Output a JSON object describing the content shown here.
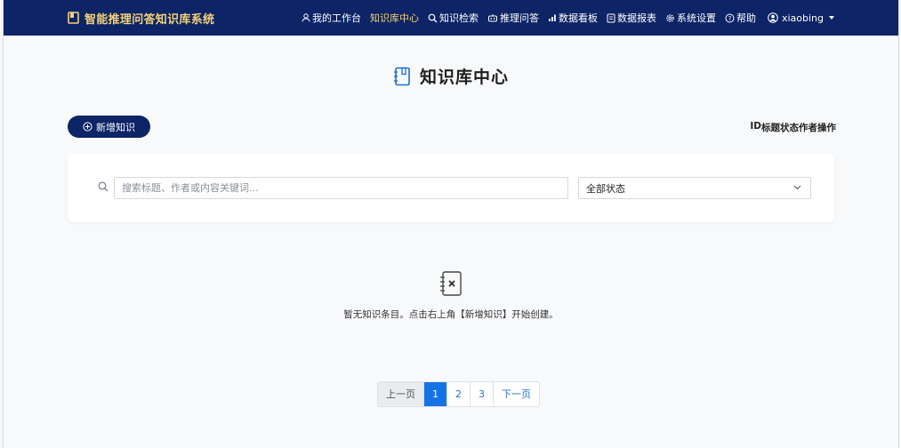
{
  "brand": {
    "title": "智能推理问答知识库系统"
  },
  "nav": {
    "items": [
      {
        "label": "我的工作台",
        "icon": "user-icon"
      },
      {
        "label": "知识库中心",
        "icon": ""
      },
      {
        "label": "知识检索",
        "icon": "search-icon"
      },
      {
        "label": "推理问答",
        "icon": "robot-icon"
      },
      {
        "label": "数据看板",
        "icon": "bar-chart-icon"
      },
      {
        "label": "数据报表",
        "icon": "report-icon"
      },
      {
        "label": "系统设置",
        "icon": "gear-icon"
      },
      {
        "label": "帮助",
        "icon": "question-icon"
      }
    ],
    "user": "xiaobing"
  },
  "page": {
    "title": "知识库中心"
  },
  "toolbar": {
    "add_label": "新增知识",
    "columns": [
      "ID",
      "标题",
      "状态",
      "作者",
      "操作"
    ]
  },
  "filter": {
    "search_placeholder": "搜索标题、作者或内容关键词...",
    "search_value": "",
    "status_selected": "全部状态"
  },
  "empty": {
    "message": "暂无知识条目。点击右上角【新增知识】开始创建。"
  },
  "pagination": {
    "prev": "上一页",
    "pages": [
      "1",
      "2",
      "3"
    ],
    "next": "下一页",
    "current": "1"
  },
  "colors": {
    "navbar": "#0d2466",
    "accent": "#f3d17a",
    "active_page": "#1673e6"
  }
}
